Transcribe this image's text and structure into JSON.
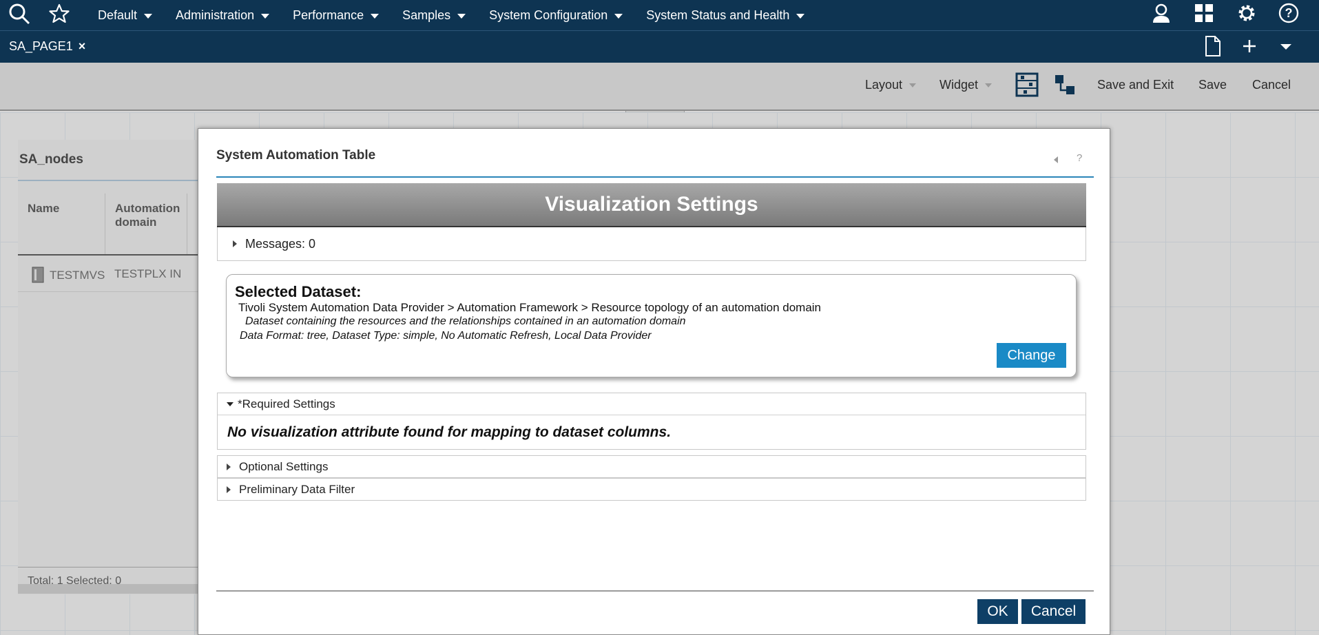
{
  "topnav": {
    "menus": [
      {
        "label": "Default"
      },
      {
        "label": "Administration"
      },
      {
        "label": "Performance"
      },
      {
        "label": "Samples"
      },
      {
        "label": "System Configuration"
      },
      {
        "label": "System Status and Health"
      }
    ],
    "icons": [
      "search-icon",
      "star-icon",
      "user-icon",
      "apps-grid-icon",
      "gear-icon",
      "help-icon"
    ]
  },
  "page_tab": {
    "label": "SA_PAGE1",
    "close": "×"
  },
  "toolbar": {
    "layout": "Layout",
    "widget": "Widget",
    "save_exit": "Save and Exit",
    "save": "Save",
    "cancel": "Cancel"
  },
  "background_widget": {
    "title": "SA_nodes",
    "columns": [
      "Name",
      "Automation domain"
    ],
    "row": {
      "name": "TESTMVS",
      "domain": "TESTPLX IN"
    },
    "footer": "Total: 1 Selected: 0"
  },
  "dialog": {
    "title": "System Automation Table",
    "help": "?",
    "header": "Visualization Settings",
    "messages": "Messages: 0",
    "dataset": {
      "heading": "Selected Dataset:",
      "path": "Tivoli System Automation Data Provider > Automation Framework > Resource topology of an automation domain",
      "description": "Dataset containing the resources and the relationships contained in an automation domain",
      "format": "Data Format: tree,  Dataset Type: simple,  No Automatic Refresh,  Local Data Provider",
      "change": "Change"
    },
    "required": {
      "label": "*Required Settings",
      "note": "No visualization attribute found for mapping to dataset columns."
    },
    "optional": "Optional Settings",
    "filter": "Preliminary Data Filter",
    "ok": "OK",
    "cancel": "Cancel"
  },
  "colors": {
    "nav": "#0e3452",
    "accent": "#1a8ac6",
    "button": "#0e3f66"
  }
}
